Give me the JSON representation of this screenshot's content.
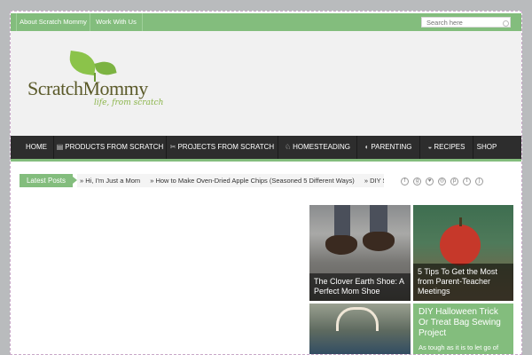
{
  "topbar": {
    "links": [
      "About Scratch Mommy",
      "Work With Us"
    ],
    "search_placeholder": "Search here"
  },
  "logo": {
    "name": "ScratchMommy",
    "tagline": "life, from scratch"
  },
  "nav": {
    "items": [
      "HOME",
      "PRODUCTS FROM SCRATCH",
      "PROJECTS FROM SCRATCH",
      "HOMESTEADING",
      "PARENTING",
      "RECIPES",
      "SHOP"
    ]
  },
  "latest": {
    "label": "Latest Posts",
    "items": [
      "» Hi, I'm Just a Mom",
      "» How to Make Oven-Dried Apple Chips (Seasoned 5 Different Ways)",
      "» DIY S"
    ]
  },
  "social": {
    "icons": [
      "facebook-icon",
      "google-plus-icon",
      "heart-icon",
      "instagram-icon",
      "pinterest-icon",
      "tumblr-icon",
      "rss-icon"
    ],
    "glyphs": [
      "f",
      "g",
      "♥",
      "◎",
      "p",
      "t",
      ")"
    ]
  },
  "posts": [
    {
      "title": "The Clover Earth Shoe: A Perfect Mom Shoe"
    },
    {
      "title": "5 Tips To Get the Most from Parent-Teacher Meetings"
    },
    {
      "title": "DIY Halloween Trick Or Treat Bag Sewing Project",
      "excerpt": "As tough as it is to let go of"
    }
  ],
  "colors": {
    "accent": "#83bd7d",
    "nav_bg": "#2d2d2d",
    "header_bg": "#f1f1f1"
  }
}
